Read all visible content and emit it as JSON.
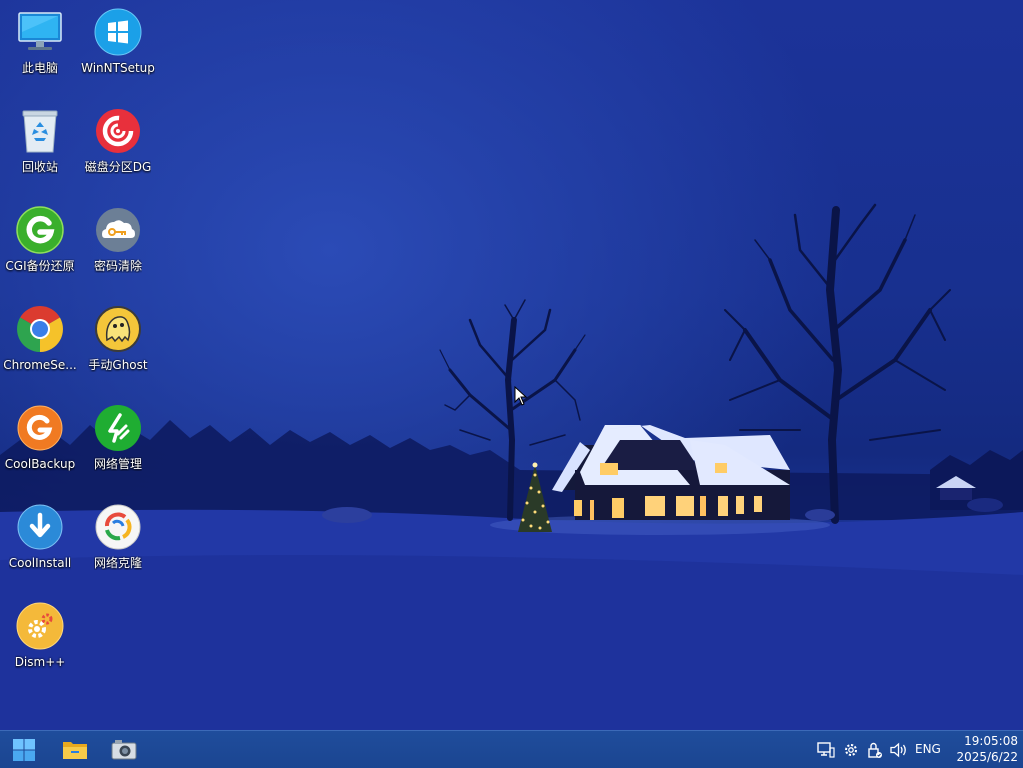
{
  "desktop": {
    "icons": [
      {
        "label": "此电脑",
        "icon": "computer-icon"
      },
      {
        "label": "WinNTSetup",
        "icon": "windows-setup-icon"
      },
      {
        "label": "回收站",
        "icon": "recycle-bin-icon"
      },
      {
        "label": "磁盘分区DG",
        "icon": "diskgenius-icon"
      },
      {
        "label": "CGI备份还原",
        "icon": "cgi-backup-icon"
      },
      {
        "label": "密码清除",
        "icon": "password-clear-icon"
      },
      {
        "label": "ChromeSe...",
        "icon": "chrome-icon"
      },
      {
        "label": "手动Ghost",
        "icon": "ghost-icon"
      },
      {
        "label": "CoolBackup",
        "icon": "coolbackup-icon"
      },
      {
        "label": "网络管理",
        "icon": "network-manager-icon"
      },
      {
        "label": "CoolInstall",
        "icon": "coolinstall-icon"
      },
      {
        "label": "网络克隆",
        "icon": "network-clone-icon"
      },
      {
        "label": "Dism++",
        "icon": "dism-icon"
      }
    ]
  },
  "taskbar": {
    "pinned": [
      {
        "icon": "start-icon"
      },
      {
        "icon": "file-explorer-icon"
      },
      {
        "icon": "screenshot-tool-icon"
      }
    ],
    "tray": [
      {
        "icon": "network-monitor-icon"
      },
      {
        "icon": "settings-gear-icon"
      },
      {
        "icon": "security-lock-icon"
      },
      {
        "icon": "volume-icon"
      }
    ],
    "language": "ENG",
    "time": "19:05:08",
    "date": "2025/6/22"
  },
  "colors": {
    "taskbar": "#1f4d9c",
    "sky": "#1c3399",
    "snow": "#2a40b0"
  }
}
